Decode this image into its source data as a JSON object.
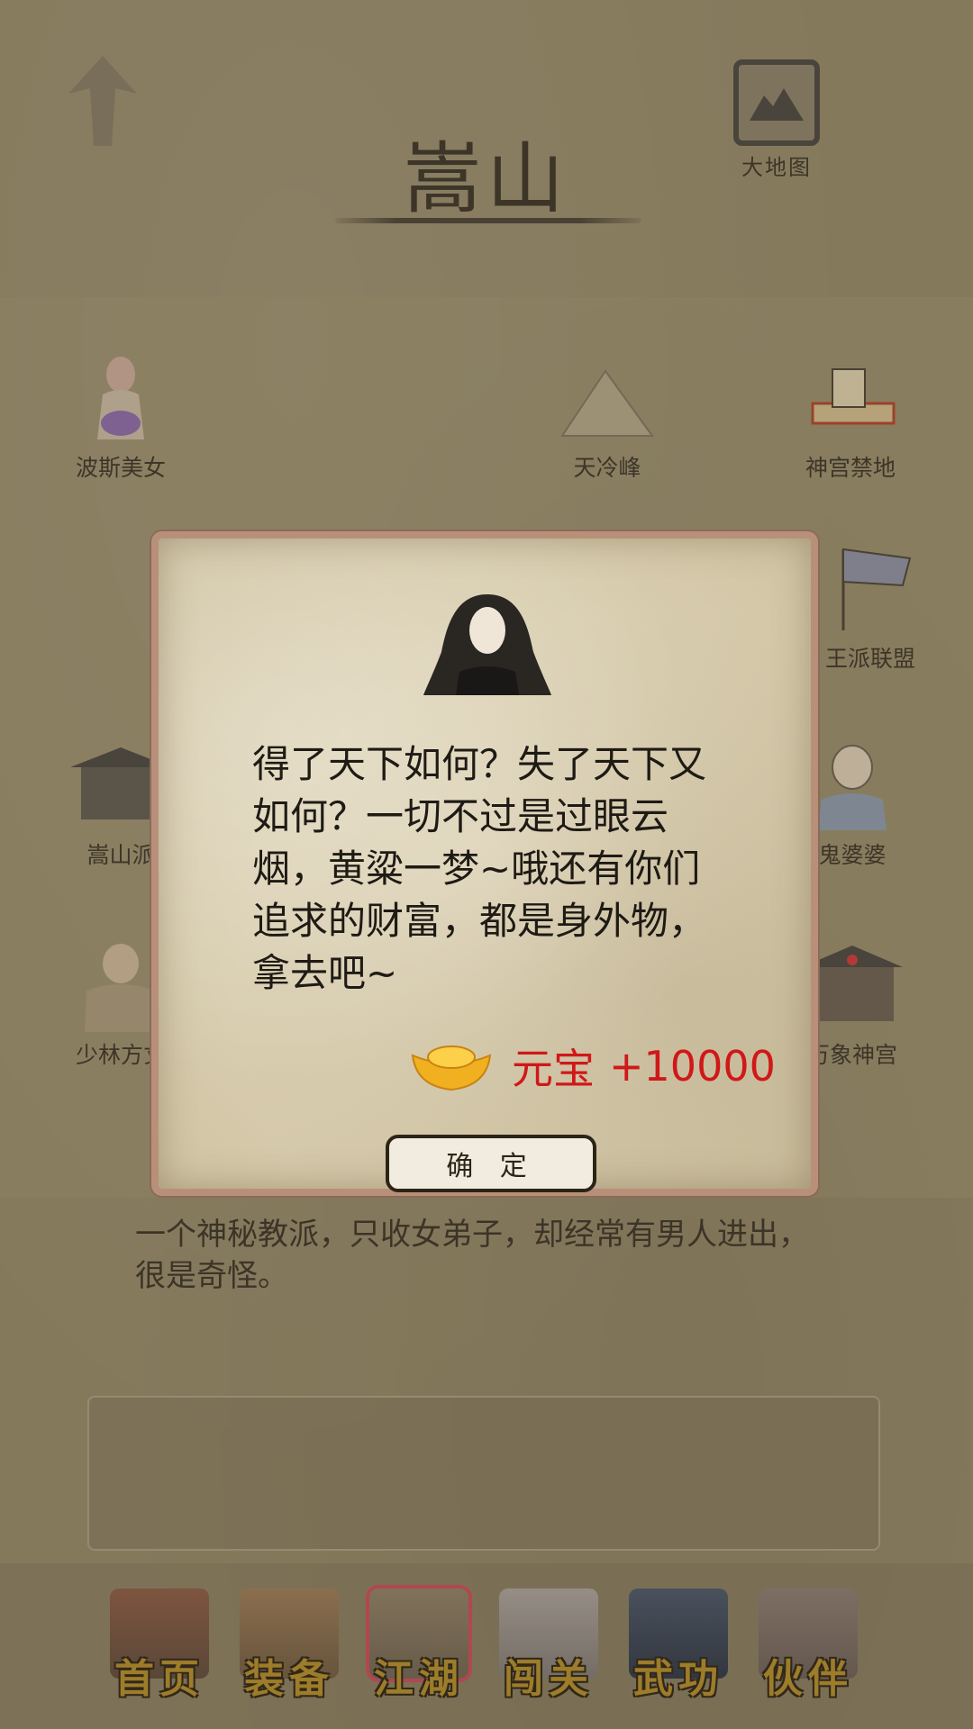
{
  "header": {
    "title": "嵩山",
    "map_label": "大地图"
  },
  "locations": [
    {
      "label": "波斯美女"
    },
    {
      "label": "天冷峰"
    },
    {
      "label": "神宫禁地"
    },
    {
      "label": "王派联盟"
    },
    {
      "label": "嵩山派"
    },
    {
      "label": "鬼婆婆"
    },
    {
      "label": "少林方丈"
    },
    {
      "label": "万象神宫"
    }
  ],
  "description": "一个神秘教派，只收女弟子，却经常有男人进出，很是奇怪。",
  "dialog": {
    "message": "得了天下如何？失了天下又如何？一切不过是过眼云烟，黄粱一梦~哦还有你们追求的财富，都是身外物，拿去吧~",
    "reward_name": "元宝",
    "reward_amount": "+10000",
    "confirm_label": "确 定"
  },
  "nav": [
    {
      "label": "首页"
    },
    {
      "label": "装备"
    },
    {
      "label": "江湖",
      "active": true
    },
    {
      "label": "闯关"
    },
    {
      "label": "武功"
    },
    {
      "label": "伙伴"
    }
  ],
  "colors": {
    "reward": "#d01818",
    "nav_text": "#b08a2a",
    "active_tab": "#c84a5a"
  }
}
